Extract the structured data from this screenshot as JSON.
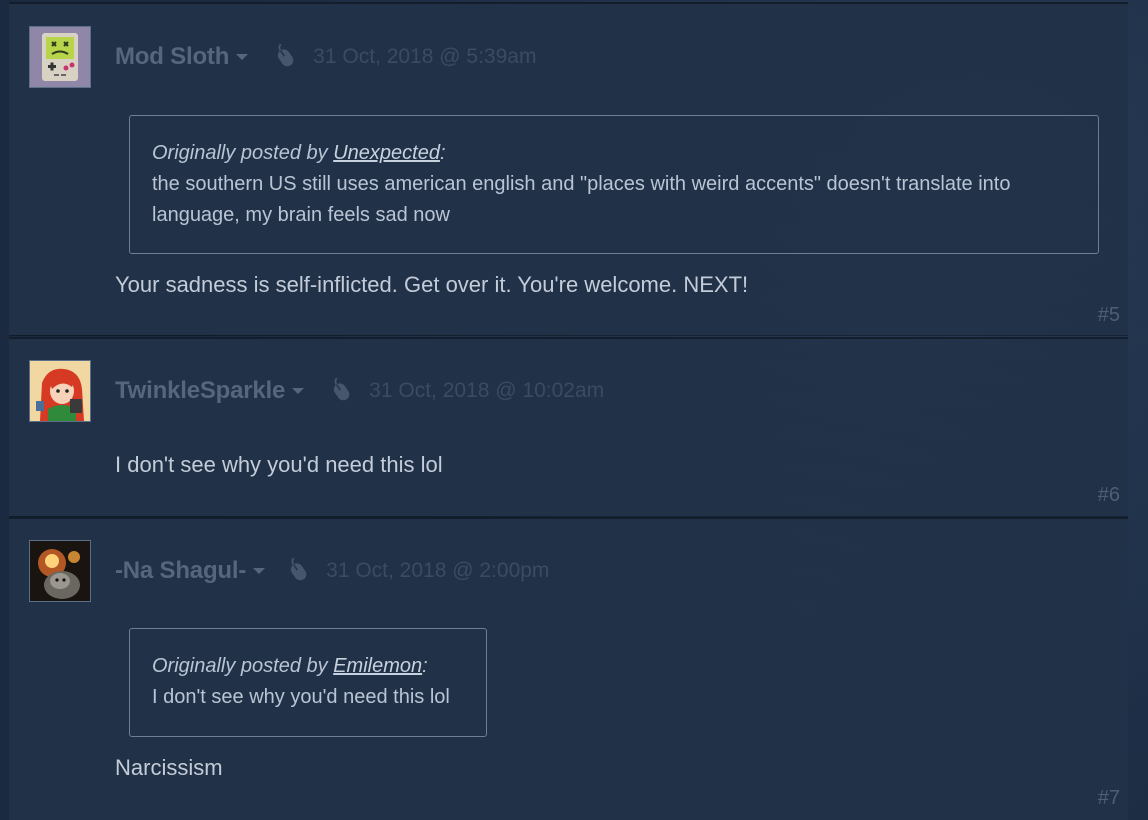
{
  "posts": [
    {
      "author": "Mod Sloth",
      "timestamp": "31 Oct, 2018 @ 5:39am",
      "quote": {
        "prefix": "Originally posted by ",
        "author": "Unexpected",
        "suffix": ":",
        "line1": "the southern US still uses american english and \"places with weird accents\" doesn't translate into",
        "line2": "language, my brain feels sad now"
      },
      "body": "Your sadness is self-inflicted. Get over it. You're welcome. NEXT!",
      "number": "#5"
    },
    {
      "author": "TwinkleSparkle",
      "timestamp": "31 Oct, 2018 @ 10:02am",
      "body": "I don't see why you'd need this lol",
      "number": "#6"
    },
    {
      "author": "-Na Shagul-",
      "timestamp": "31 Oct, 2018 @ 2:00pm",
      "quote": {
        "prefix": "Originally posted by ",
        "author": "Emilemon",
        "suffix": ":",
        "line1": "I don't see why you'd need this lol"
      },
      "body": "Narcissism",
      "number": "#7"
    }
  ],
  "colors": {
    "background": "#1b2a40",
    "post_bg": "#213148",
    "author_text": "#56667d",
    "timestamp_text": "#3a4b63",
    "body_text": "#c3ccd8",
    "quote_border": "#6b7f98"
  },
  "icons": {
    "author_menu": "chevron-down-icon",
    "device": "mouse-icon"
  }
}
